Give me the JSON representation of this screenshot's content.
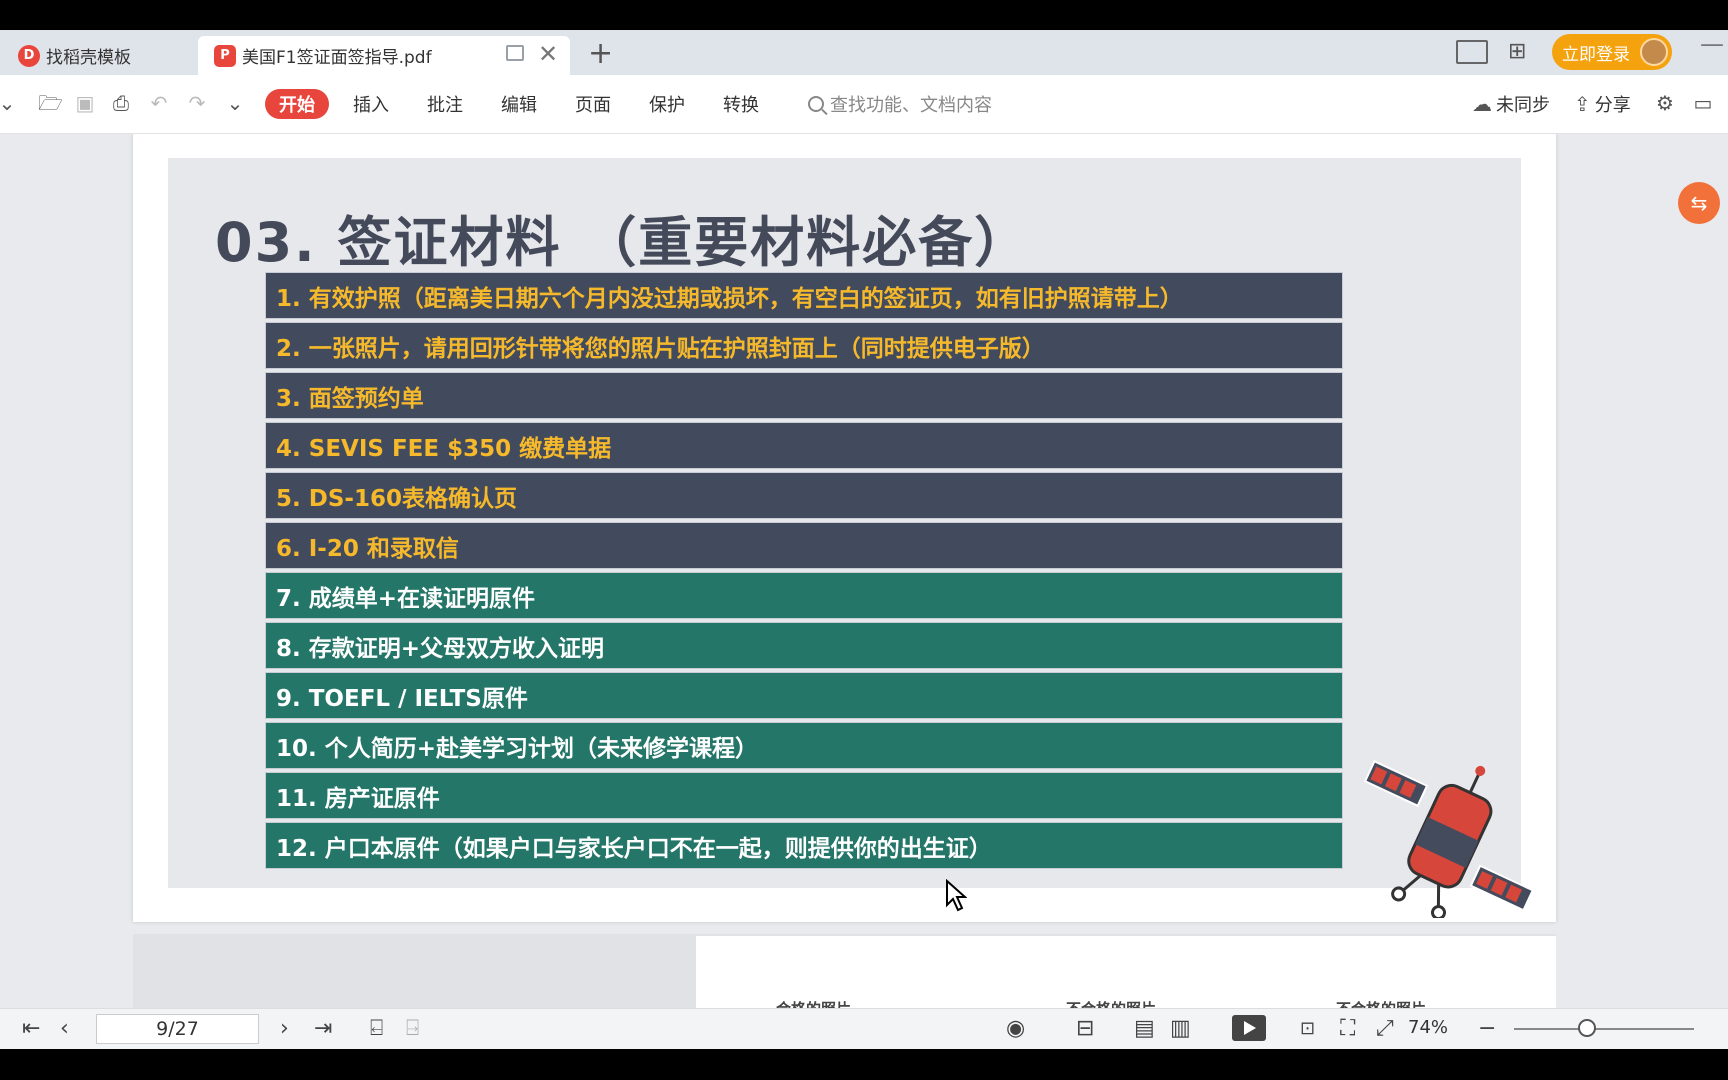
{
  "tabs": [
    {
      "label": "找稻壳模板"
    },
    {
      "label": "美国F1签证面签指导.pdf"
    }
  ],
  "header": {
    "login_label": "立即登录"
  },
  "toolbar": {
    "menus": [
      "开始",
      "插入",
      "批注",
      "编辑",
      "页面",
      "保护",
      "转换"
    ],
    "search_placeholder": "查找功能、文档内容",
    "sync_label": "未同步",
    "share_label": "分享"
  },
  "slide": {
    "title": "03. 签证材料 （重要材料必备）",
    "items": [
      {
        "text": "1. 有效护照（距离美日期六个月内没过期或损坏，有空白的签证页，如有旧护照请带上）",
        "style": "dark"
      },
      {
        "text": "2. 一张照片，请用回形针带将您的照片贴在护照封面上（同时提供电子版）",
        "style": "dark"
      },
      {
        "text": "3. 面签预约单",
        "style": "dark"
      },
      {
        "text": "4. SEVIS FEE $350 缴费单据",
        "style": "dark"
      },
      {
        "text": "5. DS-160表格确认页",
        "style": "dark"
      },
      {
        "text": "6. I-20 和录取信",
        "style": "dark"
      },
      {
        "text": "7. 成绩单+在读证明原件",
        "style": "green"
      },
      {
        "text": "8. 存款证明+父母双方收入证明",
        "style": "green"
      },
      {
        "text": "9. TOEFL / IELTS原件",
        "style": "green"
      },
      {
        "text": "10. 个人简历+赴美学习计划（未来修学课程）",
        "style": "green"
      },
      {
        "text": "11. 房产证原件",
        "style": "green"
      },
      {
        "text": "12. 户口本原件（如果户口与家长户口不在一起，则提供你的出生证）",
        "style": "green"
      }
    ],
    "colors": {
      "dark": "#424b5e",
      "green": "#237668",
      "gold": "#f6b92b"
    }
  },
  "next_page": {
    "labels": [
      "合格的照片",
      "不合格的照片",
      "不合格的照片"
    ]
  },
  "statusbar": {
    "page_indicator": "9/27",
    "zoom": "74%"
  }
}
